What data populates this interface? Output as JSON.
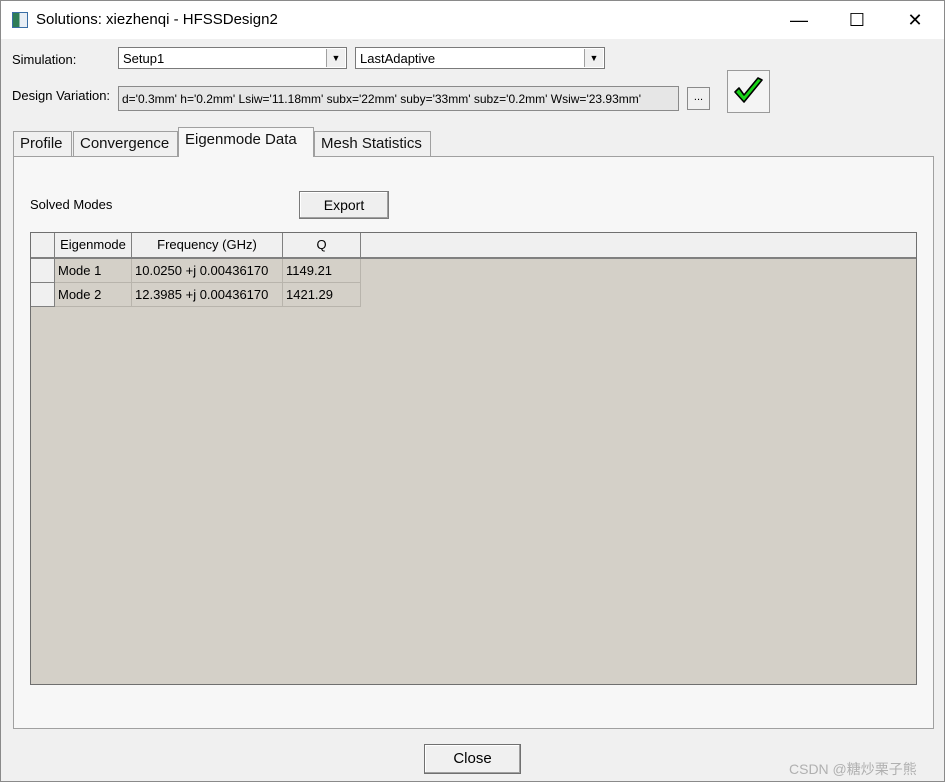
{
  "window": {
    "title": "Solutions: xiezhenqi - HFSSDesign2",
    "minimize_glyph": "—",
    "maximize_glyph": "☐",
    "close_glyph": "✕"
  },
  "simulation": {
    "label": "Simulation:",
    "setup_value": "Setup1",
    "solution_value": "LastAdaptive"
  },
  "design_variation": {
    "label": "Design Variation:",
    "value": "d='0.3mm' h='0.2mm' Lsiw='11.18mm' subx='22mm' suby='33mm' subz='0.2mm' Wsiw='23.93mm'",
    "browse_label": "...",
    "status_icon": "green-check-icon",
    "status_color": "#00cc00"
  },
  "tabs": [
    {
      "label": "Profile"
    },
    {
      "label": "Convergence"
    },
    {
      "label": "Eigenmode Data"
    },
    {
      "label": "Mesh Statistics"
    }
  ],
  "eigenmode": {
    "solved_label": "Solved Modes",
    "export_label": "Export",
    "columns": [
      "Eigenmode",
      "Frequency (GHz)",
      "Q"
    ],
    "rows": [
      {
        "mode": "Mode 1",
        "frequency": "10.0250 +j 0.00436170",
        "q": "1149.21"
      },
      {
        "mode": "Mode 2",
        "frequency": "12.3985 +j 0.00436170",
        "q": "1421.29"
      }
    ]
  },
  "footer": {
    "close_label": "Close",
    "watermark": "CSDN @糖炒栗子熊"
  }
}
